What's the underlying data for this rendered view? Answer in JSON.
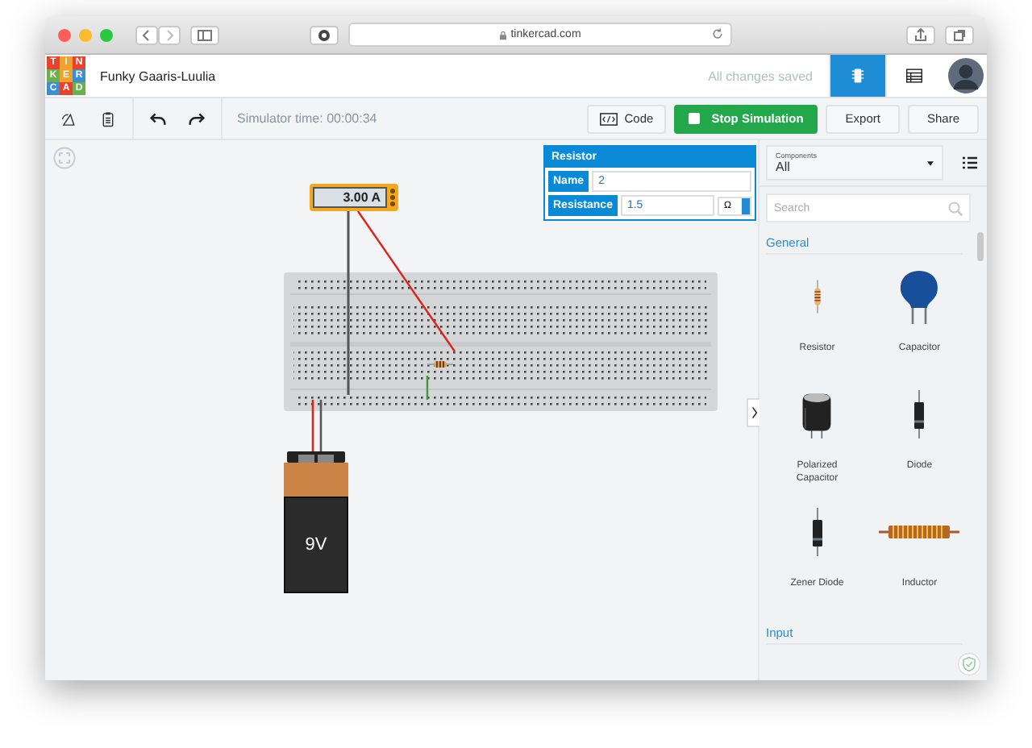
{
  "browser": {
    "address": "tinkercad.com"
  },
  "app": {
    "logo": [
      "T",
      "I",
      "N",
      "K",
      "E",
      "R",
      "C",
      "A",
      "D"
    ],
    "project_title": "Funky Gaaris-Luulia",
    "save_status": "All changes saved",
    "views": [
      {
        "kind": "circuit",
        "selected": true
      },
      {
        "kind": "list",
        "selected": false
      }
    ]
  },
  "toolbar": {
    "simulator_time": "Simulator time: 00:00:34",
    "buttons": [
      {
        "kind": "code",
        "label": "Code"
      },
      {
        "kind": "stop",
        "label": "Stop Simulation"
      },
      {
        "kind": "plain",
        "label": "Export"
      },
      {
        "kind": "plain",
        "label": "Share"
      }
    ]
  },
  "canvas": {
    "multimeter": {
      "reading": "3.00 A"
    },
    "battery": {
      "label": "9V"
    }
  },
  "inspector": {
    "title": "Resistor",
    "fields": [
      {
        "label": "Name",
        "value": "2"
      },
      {
        "label": "Resistance",
        "value": "1.5",
        "unit": "Ω"
      }
    ]
  },
  "components_panel": {
    "filter_label": "Components",
    "filter_value": "All",
    "search": {
      "placeholder": "Search"
    },
    "sections": [
      {
        "title": "General",
        "items": [
          {
            "kind": "resistor",
            "label": "Resistor"
          },
          {
            "kind": "capacitor",
            "label": "Capacitor"
          },
          {
            "kind": "polarized_capacitor",
            "label": "Polarized Capacitor"
          },
          {
            "kind": "diode",
            "label": "Diode"
          },
          {
            "kind": "zener",
            "label": "Zener Diode"
          },
          {
            "kind": "inductor",
            "label": "Inductor"
          }
        ]
      },
      {
        "title": "Input"
      }
    ]
  }
}
